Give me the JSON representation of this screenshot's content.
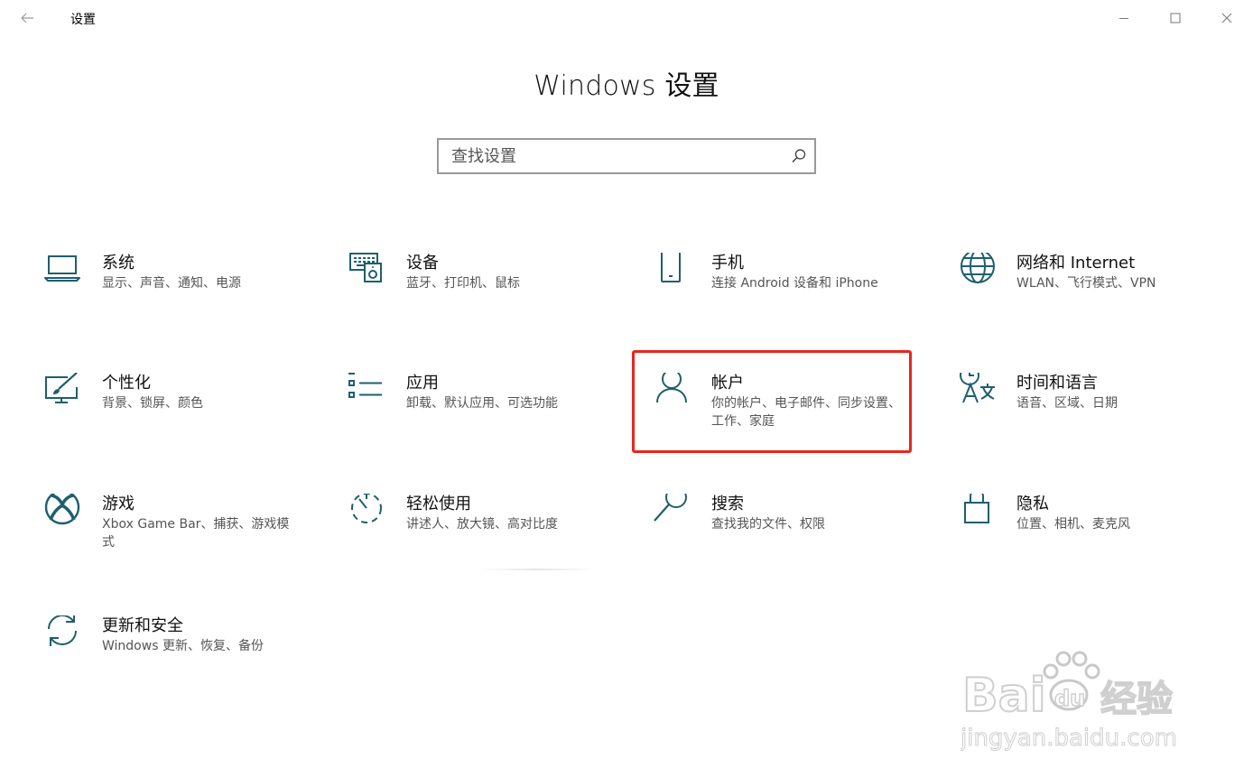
{
  "titlebar": {
    "back_icon": "arrow-left-icon",
    "title": "设置",
    "minimize_icon": "minimize-icon",
    "maximize_icon": "maximize-icon",
    "close_icon": "close-icon"
  },
  "header": {
    "title": "Windows 设置"
  },
  "search": {
    "placeholder": "查找设置",
    "value": "",
    "icon": "search-icon"
  },
  "colors": {
    "accent": "#1e5f6e",
    "highlight_border": "#e8261c"
  },
  "tiles": [
    {
      "title": "系统",
      "desc": "显示、声音、通知、电源",
      "icon": "laptop-icon"
    },
    {
      "title": "设备",
      "desc": "蓝牙、打印机、鼠标",
      "icon": "devices-icon"
    },
    {
      "title": "手机",
      "desc": "连接 Android 设备和 iPhone",
      "icon": "phone-icon"
    },
    {
      "title": "网络和 Internet",
      "desc": "WLAN、飞行模式、VPN",
      "icon": "globe-icon"
    },
    {
      "title": "个性化",
      "desc": "背景、锁屏、颜色",
      "icon": "personalization-icon"
    },
    {
      "title": "应用",
      "desc": "卸载、默认应用、可选功能",
      "icon": "apps-list-icon"
    },
    {
      "title": "帐户",
      "desc": "你的帐户、电子邮件、同步设置、工作、家庭",
      "icon": "person-icon"
    },
    {
      "title": "时间和语言",
      "desc": "语音、区域、日期",
      "icon": "time-language-icon"
    },
    {
      "title": "游戏",
      "desc": "Xbox Game Bar、捕获、游戏模式",
      "icon": "xbox-icon"
    },
    {
      "title": "轻松使用",
      "desc": "讲述人、放大镜、高对比度",
      "icon": "ease-of-access-icon"
    },
    {
      "title": "搜索",
      "desc": "查找我的文件、权限",
      "icon": "magnifier-icon"
    },
    {
      "title": "隐私",
      "desc": "位置、相机、麦克风",
      "icon": "lock-icon"
    },
    {
      "title": "更新和安全",
      "desc": "Windows 更新、恢复、备份",
      "icon": "sync-icon"
    }
  ],
  "watermark": {
    "brand": "Bai",
    "brand2": "du",
    "brand_cn": "经验",
    "url": "jingyan.baidu.com"
  }
}
